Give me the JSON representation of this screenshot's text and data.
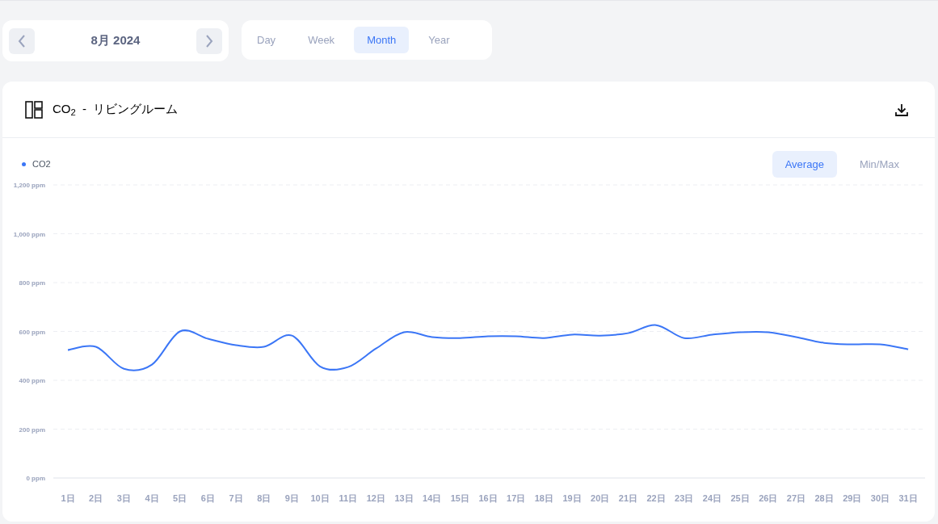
{
  "date_nav": {
    "label": "8月 2024"
  },
  "period_tabs": [
    {
      "label": "Day",
      "selected": false
    },
    {
      "label": "Week",
      "selected": false
    },
    {
      "label": "Month",
      "selected": true
    },
    {
      "label": "Year",
      "selected": false
    }
  ],
  "panel": {
    "title": "CO$_{2}$  -  リビングルーム",
    "mode_tabs": [
      {
        "label": "Average",
        "selected": true
      },
      {
        "label": "Min/Max",
        "selected": false
      }
    ],
    "chart_data": {
      "type": "line",
      "categories": [
        "1日",
        "2日",
        "3日",
        "4日",
        "5日",
        "6日",
        "7日",
        "8日",
        "9日",
        "10日",
        "11日",
        "12日",
        "13日",
        "14日",
        "15日",
        "16日",
        "17日",
        "18日",
        "19日",
        "20日",
        "21日",
        "22日",
        "23日",
        "24日",
        "25日",
        "26日",
        "27日",
        "28日",
        "29日",
        "30日",
        "31日"
      ],
      "series": [
        {
          "name": "CO2",
          "color": "#3b76f6",
          "values": [
            524,
            537,
            447,
            464,
            600,
            570,
            544,
            537,
            583,
            457,
            454,
            530,
            597,
            577,
            573,
            580,
            580,
            573,
            587,
            583,
            593,
            626,
            573,
            587,
            597,
            597,
            577,
            553,
            547,
            547,
            527
          ]
        }
      ],
      "ylim": [
        0,
        1200
      ],
      "grid": true,
      "yticks": [
        {
          "value": 0,
          "label": "0 ppm"
        },
        {
          "value": 200,
          "label": "200 ppm"
        },
        {
          "value": 400,
          "label": "400 ppm"
        },
        {
          "value": 600,
          "label": "600 ppm"
        },
        {
          "value": 800,
          "label": "800 ppm"
        },
        {
          "value": 1000,
          "label": "1,000 ppm"
        },
        {
          "value": 1200,
          "label": "1,200 ppm"
        }
      ]
    }
  }
}
